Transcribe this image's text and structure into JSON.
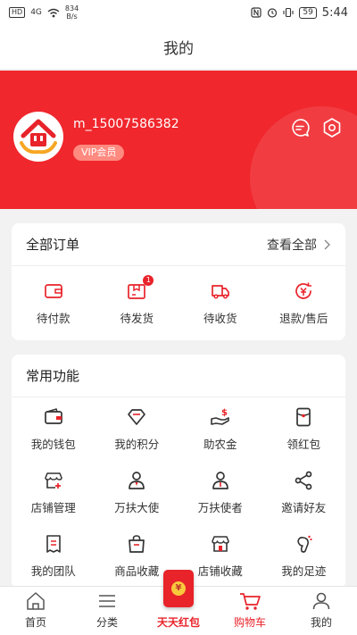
{
  "status_bar": {
    "network": "HD",
    "signal": "4G",
    "speed_value": "834",
    "speed_unit": "B/s",
    "battery": "59",
    "time": "5:44"
  },
  "header": {
    "title": "我的"
  },
  "profile": {
    "username": "m_15007586382",
    "vip_label": "VIP会员"
  },
  "orders": {
    "title": "全部订单",
    "view_all": "查看全部",
    "items": [
      {
        "label": "待付款",
        "icon": "wallet-icon"
      },
      {
        "label": "待发货",
        "icon": "package-icon",
        "badge": "1"
      },
      {
        "label": "待收货",
        "icon": "truck-icon"
      },
      {
        "label": "退款/售后",
        "icon": "refund-icon"
      }
    ]
  },
  "functions": {
    "title": "常用功能",
    "items": [
      {
        "label": "我的钱包",
        "icon": "wallet-icon"
      },
      {
        "label": "我的积分",
        "icon": "diamond-icon"
      },
      {
        "label": "助农金",
        "icon": "hand-money-icon"
      },
      {
        "label": "领红包",
        "icon": "red-envelope-icon"
      },
      {
        "label": "店铺管理",
        "icon": "store-manage-icon"
      },
      {
        "label": "万扶大使",
        "icon": "ambassador-icon"
      },
      {
        "label": "万扶使者",
        "icon": "messenger-icon"
      },
      {
        "label": "邀请好友",
        "icon": "share-icon"
      },
      {
        "label": "我的团队",
        "icon": "team-icon"
      },
      {
        "label": "商品收藏",
        "icon": "bag-icon"
      },
      {
        "label": "店铺收藏",
        "icon": "shop-icon"
      },
      {
        "label": "我的足迹",
        "icon": "footprint-icon"
      }
    ]
  },
  "tabs": [
    {
      "label": "首页",
      "icon": "home-icon"
    },
    {
      "label": "分类",
      "icon": "menu-icon"
    },
    {
      "label": "天天红包",
      "icon": "red-envelope-icon"
    },
    {
      "label": "购物车",
      "icon": "cart-icon"
    },
    {
      "label": "我的",
      "icon": "user-icon"
    }
  ],
  "colors": {
    "brand_red": "#f0272d",
    "icon_dark": "#333333"
  }
}
